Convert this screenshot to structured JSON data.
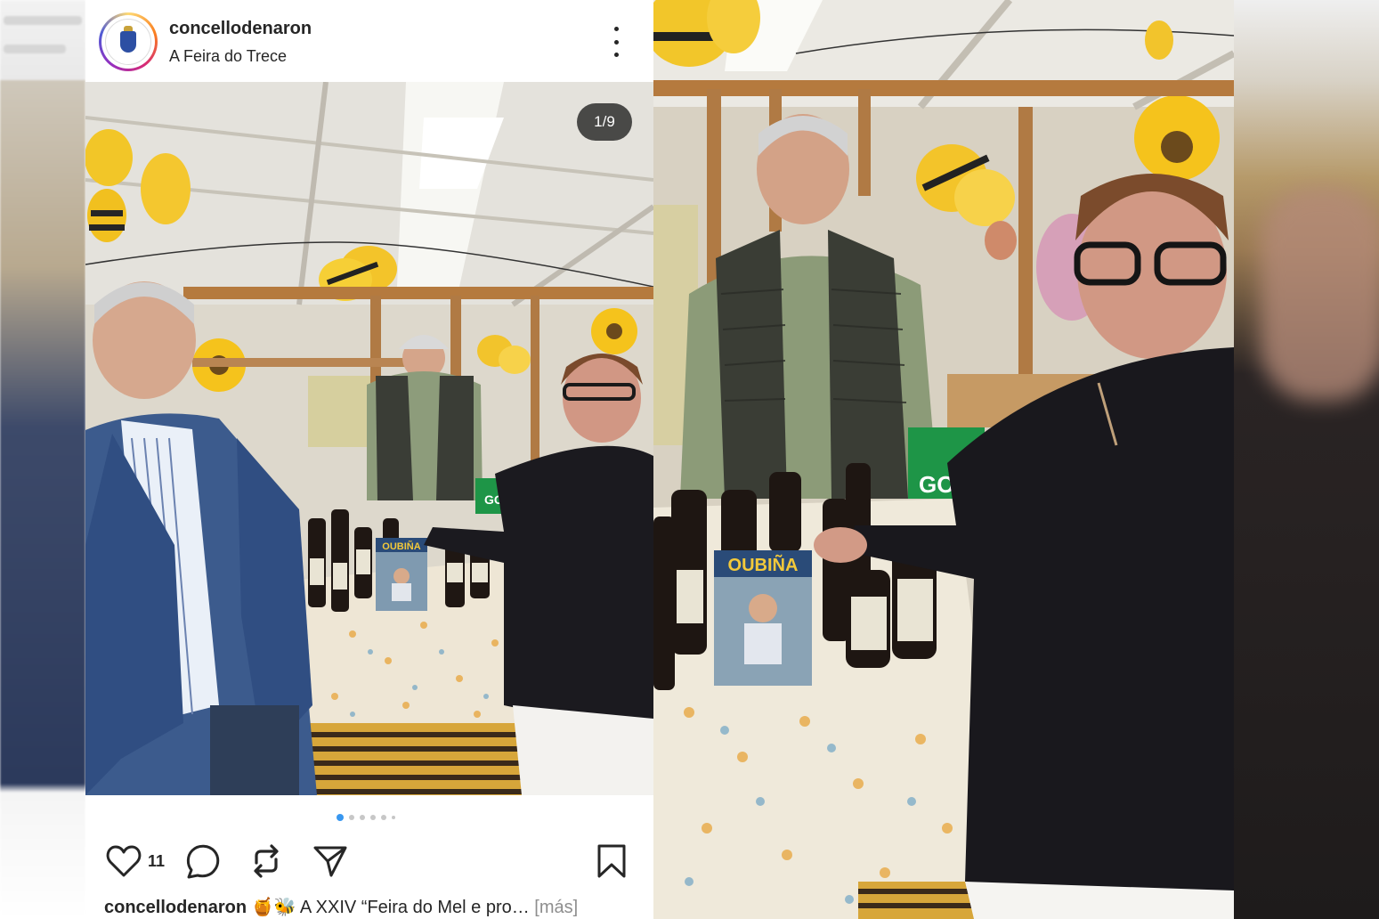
{
  "post": {
    "username": "concellodenaron",
    "location": "A Feira do Trece",
    "image_counter": "1/9",
    "like_count": "11",
    "caption": {
      "username": "concellodenaron",
      "emojis": "🍯🐝",
      "text": " A XXIV “Feira do Mel e pro…",
      "more_label": " [más]"
    },
    "carousel": {
      "total_dots": 6,
      "active_index": 0
    }
  },
  "icons": {
    "more": "more-options-icon",
    "like": "heart-icon",
    "comment": "comment-icon",
    "repost": "repost-icon",
    "share": "send-icon",
    "save": "bookmark-icon"
  },
  "photo_text": {
    "book_title": "OUBIÑA",
    "sign_text": "GOI"
  },
  "colors": {
    "text": "#262626",
    "secondary_text": "#8e8e8e",
    "active_dot": "#3897f0",
    "inactive_dot": "#c7c7c7"
  }
}
